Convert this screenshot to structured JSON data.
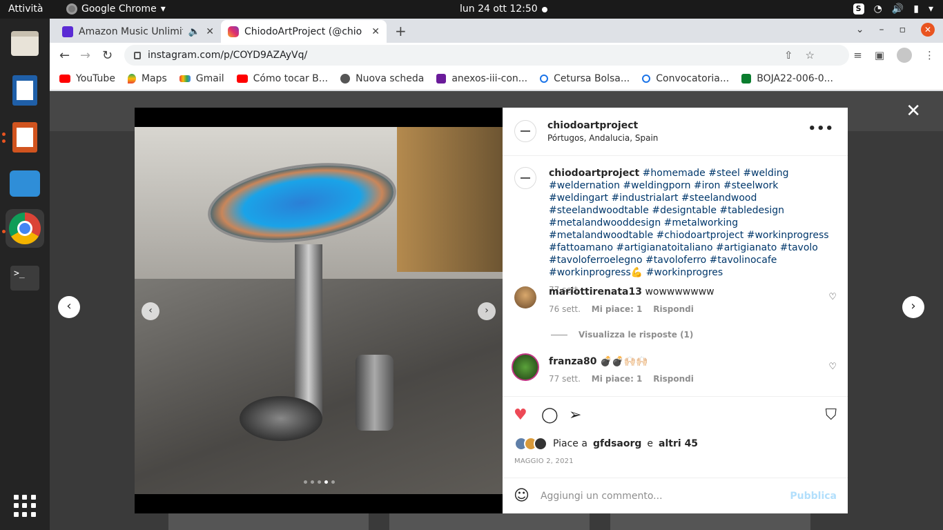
{
  "topbar": {
    "activities": "Attività",
    "app": "Google Chrome",
    "clock": "lun 24 ott  12:50"
  },
  "chrome": {
    "tabs": [
      {
        "title": "Amazon Music Unlimit",
        "icon": "amazon-music-icon",
        "audio": true
      },
      {
        "title": "ChiodoArtProject (@chio",
        "icon": "instagram-icon",
        "active": true
      }
    ],
    "url": "instagram.com/p/COYD9AZAyVq/",
    "bookmarks": [
      {
        "label": "YouTube",
        "icon": "youtube-icon"
      },
      {
        "label": "Maps",
        "icon": "maps-icon"
      },
      {
        "label": "Gmail",
        "icon": "gmail-icon"
      },
      {
        "label": "Cómo tocar B...",
        "icon": "youtube-icon"
      },
      {
        "label": "Nuova scheda",
        "icon": "globe-icon"
      },
      {
        "label": "anexos-iii-con...",
        "icon": "document-icon"
      },
      {
        "label": "Cetursa Bolsa...",
        "icon": "ring-icon"
      },
      {
        "label": "Convocatoria...",
        "icon": "ring-icon"
      },
      {
        "label": "BOJA22-006-0...",
        "icon": "junta-icon"
      }
    ]
  },
  "post": {
    "author": "chiodoartproject",
    "location": "Pórtugos, Andalucia, Spain",
    "caption_user": "chiodoartproject",
    "caption_tags": "#homemade #steel #welding #weldernation #weldingporn #iron #steelwork #weldingart #industrialart #steelandwood #steelandwoodtable #designtable #tabledesign #metalandwooddesign #metalworking #metalandwoodtable #chiodoartproject #workinprogress #fattoamano #artigianatoitaliano #artigianato #tavolo #tavoloferroelegno #tavoloferro #tavolinocafe #workinprogress💪 #workinprogres",
    "caption_time": "77 sett.",
    "comments": [
      {
        "user": "mariottirenata13",
        "text": "wowwwwwww",
        "time": "76 sett.",
        "likes": "Mi piace: 1",
        "reply": "Rispondi"
      },
      {
        "user": "franza80",
        "text": "💣💣🙌🏻🙌🏻",
        "time": "77 sett.",
        "likes": "Mi piace: 1",
        "reply": "Rispondi"
      }
    ],
    "view_replies": "Visualizza le risposte (1)",
    "likes_prefix": "Piace a",
    "likes_user": "gfdsaorg",
    "likes_and": "e",
    "likes_others": "altri 45",
    "date": "MAGGIO 2, 2021",
    "comment_placeholder": "Aggiungi un commento...",
    "publish": "Pubblica",
    "carousel": {
      "count": 5,
      "active_index": 3
    }
  },
  "colors": {
    "like": "#ed4956",
    "link": "#00376b",
    "publish_disabled": "#b2dffc"
  }
}
